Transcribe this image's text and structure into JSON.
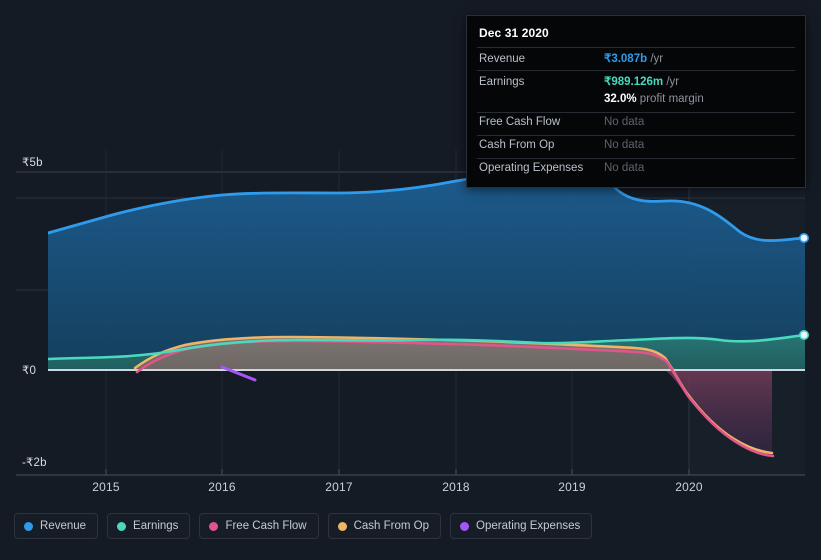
{
  "chart_data": {
    "type": "area",
    "title": "",
    "xlabel": "",
    "ylabel": "",
    "currency": "₹",
    "ylim": [
      -2000000000,
      5000000000
    ],
    "grid": true,
    "legend_position": "bottom",
    "x_tick_labels": [
      "2015",
      "2016",
      "2017",
      "2018",
      "2019",
      "2020"
    ],
    "y_tick_labels": [
      "₹5b",
      "₹0",
      "-₹2b"
    ],
    "y_tick_values": [
      5000000000,
      0,
      -2000000000
    ],
    "series": [
      {
        "name": "Revenue",
        "color": "#2f9bed",
        "x": [
          2014.5,
          2014.85,
          2015.2,
          2015.55,
          2015.9,
          2016.25,
          2016.6,
          2016.95,
          2017.3,
          2017.65,
          2018.0,
          2018.35,
          2018.7,
          2019.05,
          2019.22,
          2019.55,
          2019.9,
          2020.25,
          2020.6,
          2020.99
        ],
        "values": [
          3.3,
          3.46,
          3.62,
          3.78,
          3.96,
          4.06,
          4.08,
          4.05,
          4.05,
          4.1,
          4.22,
          4.4,
          4.6,
          4.62,
          4.34,
          4.26,
          4.22,
          3.82,
          3.1,
          3.09
        ]
      },
      {
        "name": "Earnings",
        "color": "#4ad9bf",
        "x": [
          2014.5,
          2014.85,
          2015.2,
          2015.55,
          2015.9,
          2016.25,
          2016.6,
          2016.95,
          2017.3,
          2017.65,
          2018.0,
          2018.35,
          2018.7,
          2019.05,
          2019.4,
          2019.75,
          2020.1,
          2020.45,
          2020.99
        ],
        "values": [
          0.24,
          0.25,
          0.26,
          0.27,
          0.36,
          0.46,
          0.52,
          0.56,
          0.56,
          0.55,
          0.56,
          0.6,
          0.64,
          0.62,
          0.6,
          0.66,
          0.72,
          0.82,
          0.99
        ]
      },
      {
        "name": "Free Cash Flow",
        "color": "#e0558a",
        "x": [
          2015.25,
          2015.45,
          2015.75,
          2016.1,
          2016.5,
          2016.9,
          2017.3,
          2017.7,
          2018.1,
          2018.5,
          2018.9,
          2019.25,
          2019.55,
          2019.85,
          2020.15,
          2020.45,
          2020.72
        ],
        "values": [
          -0.04,
          0.22,
          0.42,
          0.6,
          0.68,
          0.71,
          0.72,
          0.71,
          0.7,
          0.68,
          0.64,
          0.62,
          0.3,
          -0.55,
          -1.2,
          -1.6,
          -1.8
        ]
      },
      {
        "name": "Cash From Op",
        "color": "#eeb569",
        "x": [
          2015.2,
          2015.45,
          2015.75,
          2016.1,
          2016.5,
          2016.9,
          2017.3,
          2017.7,
          2018.1,
          2018.5,
          2018.9,
          2019.25,
          2019.55,
          2019.85,
          2020.15,
          2020.45,
          2020.72
        ],
        "values": [
          0.05,
          0.3,
          0.5,
          0.68,
          0.76,
          0.79,
          0.8,
          0.79,
          0.78,
          0.76,
          0.72,
          0.7,
          0.36,
          -0.5,
          -1.16,
          -1.56,
          -1.77
        ]
      },
      {
        "name": "Operating Expenses",
        "color": "#a855f7",
        "x": [
          2016.0,
          2016.28
        ],
        "values": [
          0.04,
          -0.22
        ]
      }
    ]
  },
  "tooltip": {
    "date": "Dec 31 2020",
    "rows": [
      {
        "label": "Revenue",
        "value": "₹3.087b",
        "unit": " /yr",
        "style": "rev",
        "no_data": false
      },
      {
        "label": "Earnings",
        "value": "₹989.126m",
        "unit": " /yr",
        "style": "earn",
        "no_data": false
      },
      {
        "label": "",
        "value": "32.0%",
        "unit": " profit margin",
        "style": "white",
        "no_data": false,
        "sub": true
      },
      {
        "label": "Free Cash Flow",
        "value": "No data",
        "unit": "",
        "style": "none",
        "no_data": true
      },
      {
        "label": "Cash From Op",
        "value": "No data",
        "unit": "",
        "style": "none",
        "no_data": true
      },
      {
        "label": "Operating Expenses",
        "value": "No data",
        "unit": "",
        "style": "none",
        "no_data": true
      }
    ]
  },
  "legend": {
    "items": [
      {
        "label": "Revenue",
        "color": "#2f9bed"
      },
      {
        "label": "Earnings",
        "color": "#4ad9bf"
      },
      {
        "label": "Free Cash Flow",
        "color": "#e0558a"
      },
      {
        "label": "Cash From Op",
        "color": "#eeb569"
      },
      {
        "label": "Operating Expenses",
        "color": "#a855f7"
      }
    ]
  }
}
